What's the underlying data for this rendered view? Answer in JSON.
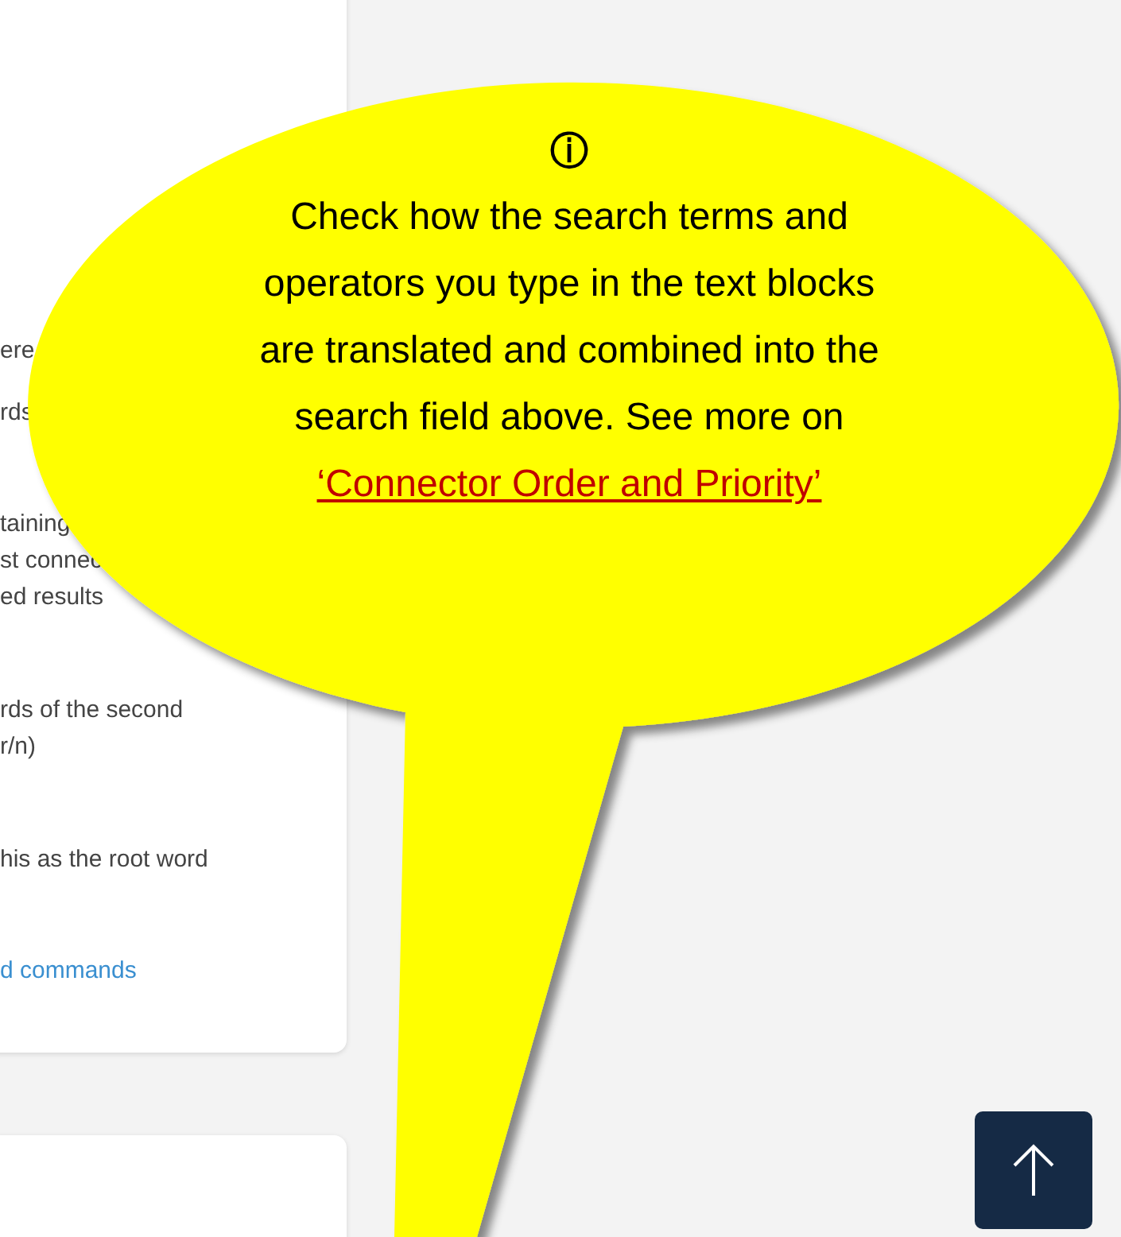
{
  "left_panel": {
    "items": [
      {
        "kind": "text",
        "lines": [
          "ere"
        ]
      },
      {
        "kind": "text",
        "lines": [
          "rds"
        ]
      },
      {
        "kind": "text",
        "lines": [
          "taining",
          "st connec",
          "ed results"
        ]
      },
      {
        "kind": "text",
        "lines": [
          "rds of the second",
          "r/n)"
        ]
      },
      {
        "kind": "text",
        "lines": [
          "his as the root word"
        ]
      },
      {
        "kind": "link",
        "lines": [
          "d commands"
        ]
      }
    ]
  },
  "callout": {
    "icon": "ⓘ",
    "text": "Check how the search terms and operators you type in the text blocks are translated and combined into the search field above. See more on",
    "link": "‘Connector Order and Priority’"
  }
}
